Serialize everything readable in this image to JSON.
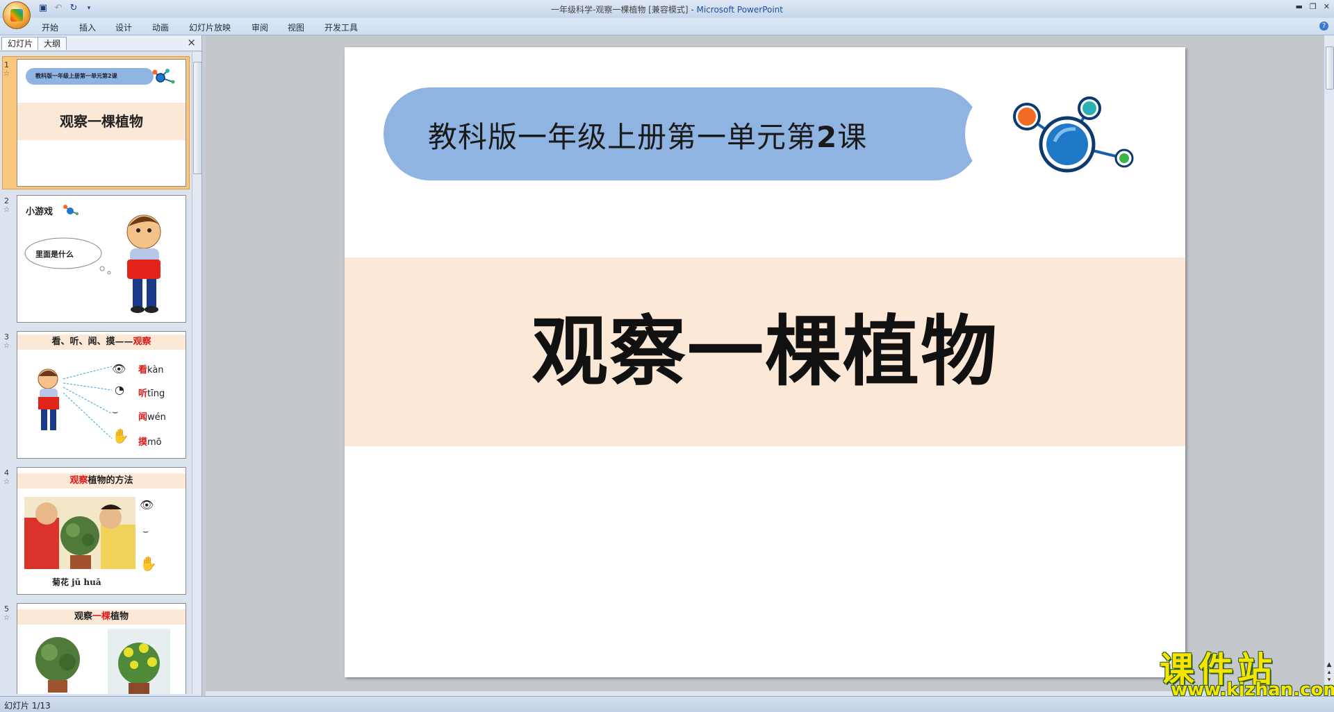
{
  "window": {
    "title": "一年级科学-观察一棵植物 [兼容模式]",
    "separator": " - ",
    "app_name": "Microsoft PowerPoint"
  },
  "menu": [
    "开始",
    "插入",
    "设计",
    "动画",
    "幻灯片放映",
    "审阅",
    "视图",
    "开发工具"
  ],
  "panel": {
    "tabs": [
      "幻灯片",
      "大纲"
    ],
    "close_label": "×"
  },
  "thumbnails": [
    {
      "num": "1",
      "subtitle": "教科版一年级上册第一单元第2课",
      "title": "观察一棵植物"
    },
    {
      "num": "2",
      "title": "小游戏",
      "bubble": "里面是什么"
    },
    {
      "num": "3",
      "title_a": "看、听、闻、摸——",
      "title_b": "观察",
      "senses": [
        {
          "char": "看",
          "pinyin": "kàn"
        },
        {
          "char": "听",
          "pinyin": "tīng"
        },
        {
          "char": "闻",
          "pinyin": "wén"
        },
        {
          "char": "摸",
          "pinyin": "mō"
        }
      ]
    },
    {
      "num": "4",
      "title_a": "观察",
      "title_b": "植物的方法",
      "caption": "菊花 jū huā"
    },
    {
      "num": "5",
      "title_a": "观察",
      "title_b": "一",
      "title_c": "棵",
      "title_d": "植物"
    }
  ],
  "slide": {
    "subtitle_text": "教科版一年级上册第一单元第",
    "subtitle_num": "2",
    "subtitle_end": "课",
    "title": "观察一棵植物"
  },
  "watermark": {
    "cn": "课件站",
    "url": "www.kjzhan.com"
  },
  "status": {
    "slide_counter": "幻灯片 1/13"
  },
  "colors": {
    "pill": "#8fb4e2",
    "band": "#fbe8d6",
    "accent_red": "#e01818",
    "selected_thumb": "#f9c77b"
  },
  "icons": [
    "office-button-icon",
    "save-icon",
    "undo-icon",
    "redo-icon",
    "qat-dropdown-icon",
    "help-icon",
    "molecule-icon",
    "close-icon"
  ]
}
